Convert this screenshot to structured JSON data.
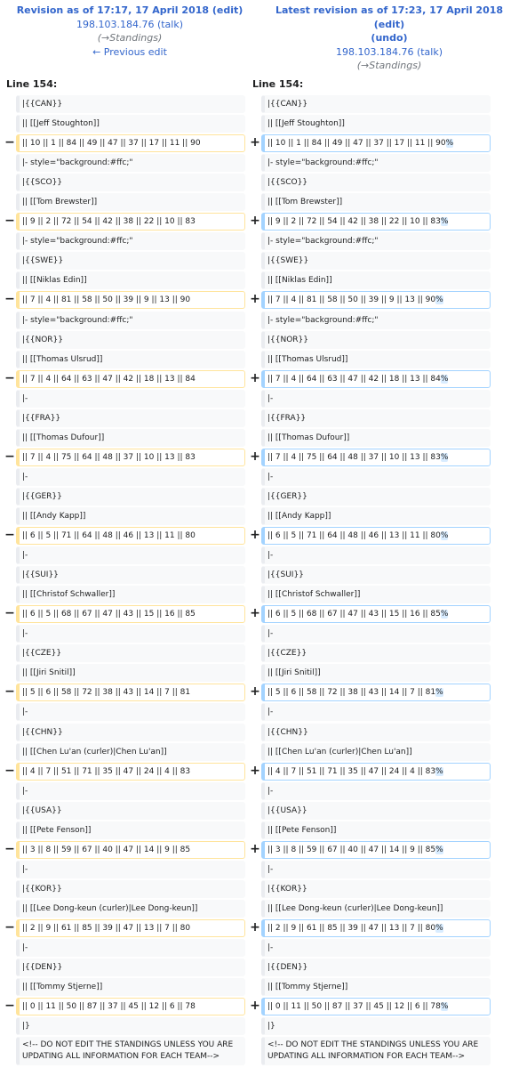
{
  "left_header": {
    "title": "Revision as of 17:17, 17 April 2018",
    "edit": "(edit)",
    "user": "198.103.184.76",
    "talk": "(talk)",
    "summary": "(→Standings)",
    "nav": "← Previous edit"
  },
  "right_header": {
    "title": "Latest revision as of 17:23, 17 April 2018",
    "edit": "(edit)",
    "undo": "(undo)",
    "user": "198.103.184.76",
    "talk": "(talk)",
    "summary": "(→Standings)"
  },
  "line_label": "Line 154:",
  "marker_del": "−",
  "marker_add": "+",
  "diff_rows": [
    {
      "type": "ctx",
      "text": "|{{CAN}}"
    },
    {
      "type": "ctx",
      "text": "|| [[Jeff Stoughton]]"
    },
    {
      "type": "chg",
      "left": "|| 10 || 1 || 84 || 49 || 47 || 37 || 17 || 11 || 90",
      "right": "|| 10 || 1 || 84 || 49 || 47 || 37 || 17 || 11 || 90",
      "add": "%"
    },
    {
      "type": "ctx",
      "text": "|- style=\"background:#ffc;\""
    },
    {
      "type": "ctx",
      "text": "|{{SCO}}"
    },
    {
      "type": "ctx",
      "text": "|| [[Tom Brewster]]"
    },
    {
      "type": "chg",
      "left": "|| 9 || 2 || 72 || 54 || 42 || 38 || 22 || 10 || 83",
      "right": "|| 9 || 2 || 72 || 54 || 42 || 38 || 22 || 10 || 83",
      "add": "%"
    },
    {
      "type": "ctx",
      "text": "|- style=\"background:#ffc;\""
    },
    {
      "type": "ctx",
      "text": "|{{SWE}}"
    },
    {
      "type": "ctx",
      "text": "|| [[Niklas Edin]]"
    },
    {
      "type": "chg",
      "left": "|| 7 || 4 || 81 || 58 || 50 || 39 || 9 || 13 || 90",
      "right": "|| 7 || 4 || 81 || 58 || 50 || 39 || 9 || 13 || 90",
      "add": "%"
    },
    {
      "type": "ctx",
      "text": "|- style=\"background:#ffc;\""
    },
    {
      "type": "ctx",
      "text": "|{{NOR}}"
    },
    {
      "type": "ctx",
      "text": "|| [[Thomas Ulsrud]]"
    },
    {
      "type": "chg",
      "left": "|| 7 || 4 || 64 || 63 || 47 || 42 || 18 || 13 || 84",
      "right": "|| 7 || 4 || 64 || 63 || 47 || 42 || 18 || 13 || 84",
      "add": "%"
    },
    {
      "type": "ctx",
      "text": "|-"
    },
    {
      "type": "ctx",
      "text": "|{{FRA}}"
    },
    {
      "type": "ctx",
      "text": "|| [[Thomas Dufour]]"
    },
    {
      "type": "chg",
      "left": "|| 7 || 4 || 75 || 64 || 48 || 37 || 10 || 13 || 83",
      "right": "|| 7 || 4 || 75 || 64 || 48 || 37 || 10 || 13 || 83",
      "add": "%"
    },
    {
      "type": "ctx",
      "text": "|-"
    },
    {
      "type": "ctx",
      "text": "|{{GER}}"
    },
    {
      "type": "ctx",
      "text": "|| [[Andy Kapp]]"
    },
    {
      "type": "chg",
      "left": "|| 6 || 5 || 71 || 64 || 48 || 46 || 13 || 11 || 80",
      "right": "|| 6 || 5 || 71 || 64 || 48 || 46 || 13 || 11 || 80",
      "add": "%"
    },
    {
      "type": "ctx",
      "text": "|-"
    },
    {
      "type": "ctx",
      "text": "|{{SUI}}"
    },
    {
      "type": "ctx",
      "text": "|| [[Christof Schwaller]]"
    },
    {
      "type": "chg",
      "left": "|| 6 || 5 || 68 || 67 || 47 || 43 || 15 || 16 || 85",
      "right": "|| 6 || 5 || 68 || 67 || 47 || 43 || 15 || 16 || 85",
      "add": "%"
    },
    {
      "type": "ctx",
      "text": "|-"
    },
    {
      "type": "ctx",
      "text": "|{{CZE}}"
    },
    {
      "type": "ctx",
      "text": "|| [[Jiri Snitil]]"
    },
    {
      "type": "chg",
      "left": "|| 5 || 6 || 58 || 72 || 38 || 43 || 14 || 7 || 81",
      "right": "|| 5 || 6 || 58 || 72 || 38 || 43 || 14 || 7 || 81",
      "add": "%"
    },
    {
      "type": "ctx",
      "text": "|-"
    },
    {
      "type": "ctx",
      "text": "|{{CHN}}"
    },
    {
      "type": "ctx",
      "text": "|| [[Chen Lu'an (curler)|Chen Lu'an]]"
    },
    {
      "type": "chg",
      "left": "|| 4 || 7 || 51 || 71 || 35 || 47 || 24 || 4 || 83",
      "right": "|| 4 || 7 || 51 || 71 || 35 || 47 || 24 || 4 || 83",
      "add": "%"
    },
    {
      "type": "ctx",
      "text": "|-"
    },
    {
      "type": "ctx",
      "text": "|{{USA}}"
    },
    {
      "type": "ctx",
      "text": "|| [[Pete Fenson]]"
    },
    {
      "type": "chg",
      "left": "|| 3 || 8 || 59 || 67 || 40 || 47 || 14 || 9 || 85",
      "right": "|| 3 || 8 || 59 || 67 || 40 || 47 || 14 || 9 || 85",
      "add": "%"
    },
    {
      "type": "ctx",
      "text": "|-"
    },
    {
      "type": "ctx",
      "text": "|{{KOR}}"
    },
    {
      "type": "ctx",
      "text": "|| [[Lee Dong-keun (curler)|Lee Dong-keun]]"
    },
    {
      "type": "chg",
      "left": "|| 2 || 9 || 61 || 85 || 39 || 47 || 13 || 7 || 80",
      "right": "|| 2 || 9 || 61 || 85 || 39 || 47 || 13 || 7 || 80",
      "add": "%"
    },
    {
      "type": "ctx",
      "text": "|-"
    },
    {
      "type": "ctx",
      "text": "|{{DEN}}"
    },
    {
      "type": "ctx",
      "text": "|| [[Tommy Stjerne]]"
    },
    {
      "type": "chg",
      "left": "|| 0 || 11 || 50 || 87 || 37 || 45 || 12 || 6 || 78",
      "right": "|| 0 || 11 || 50 || 87 || 37 || 45 || 12 || 6 || 78",
      "add": "%"
    },
    {
      "type": "ctx",
      "text": "|}"
    },
    {
      "type": "ctx",
      "tall": true,
      "text": "<!-- DO NOT EDIT THE STANDINGS UNLESS YOU ARE UPDATING ALL INFORMATION FOR EACH TEAM-->"
    }
  ]
}
